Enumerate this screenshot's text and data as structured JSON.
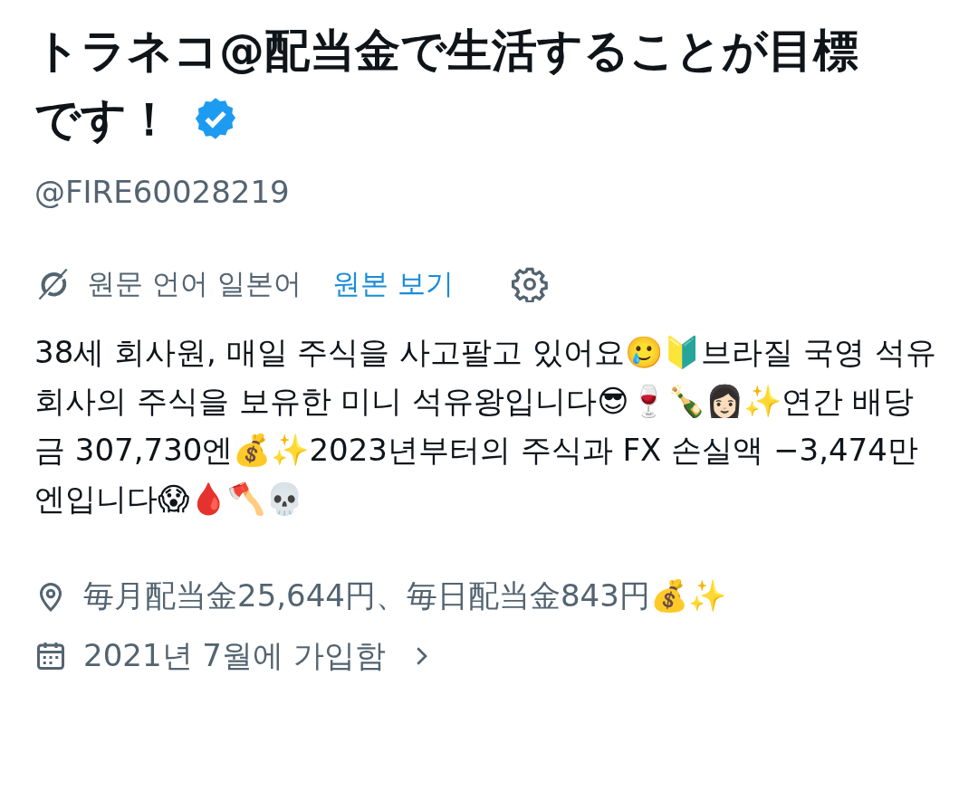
{
  "profile": {
    "name": "トラネコ@配当金で生活することが目標です！",
    "verified": true,
    "handle": "@FIRE60028219"
  },
  "translation": {
    "source_label": "원문 언어 일본어",
    "link": "원본 보기"
  },
  "bio": "38세 회사원, 매일 주식을 사고팔고 있어요🥲🔰브라질 국영 석유 회사의 주식을 보유한 미니 석유왕입니다😎🍷🍾👩🏻✨연간 배당금 307,730엔💰✨2023년부터의 주식과 FX 손실액 −3,474만 엔입니다😱🩸🪓💀",
  "meta": [
    {
      "kind": "location",
      "text": "毎月配当金25,644円、毎日配当金843円💰✨"
    },
    {
      "kind": "joined",
      "text": "2021년 7월에 가입함"
    }
  ]
}
